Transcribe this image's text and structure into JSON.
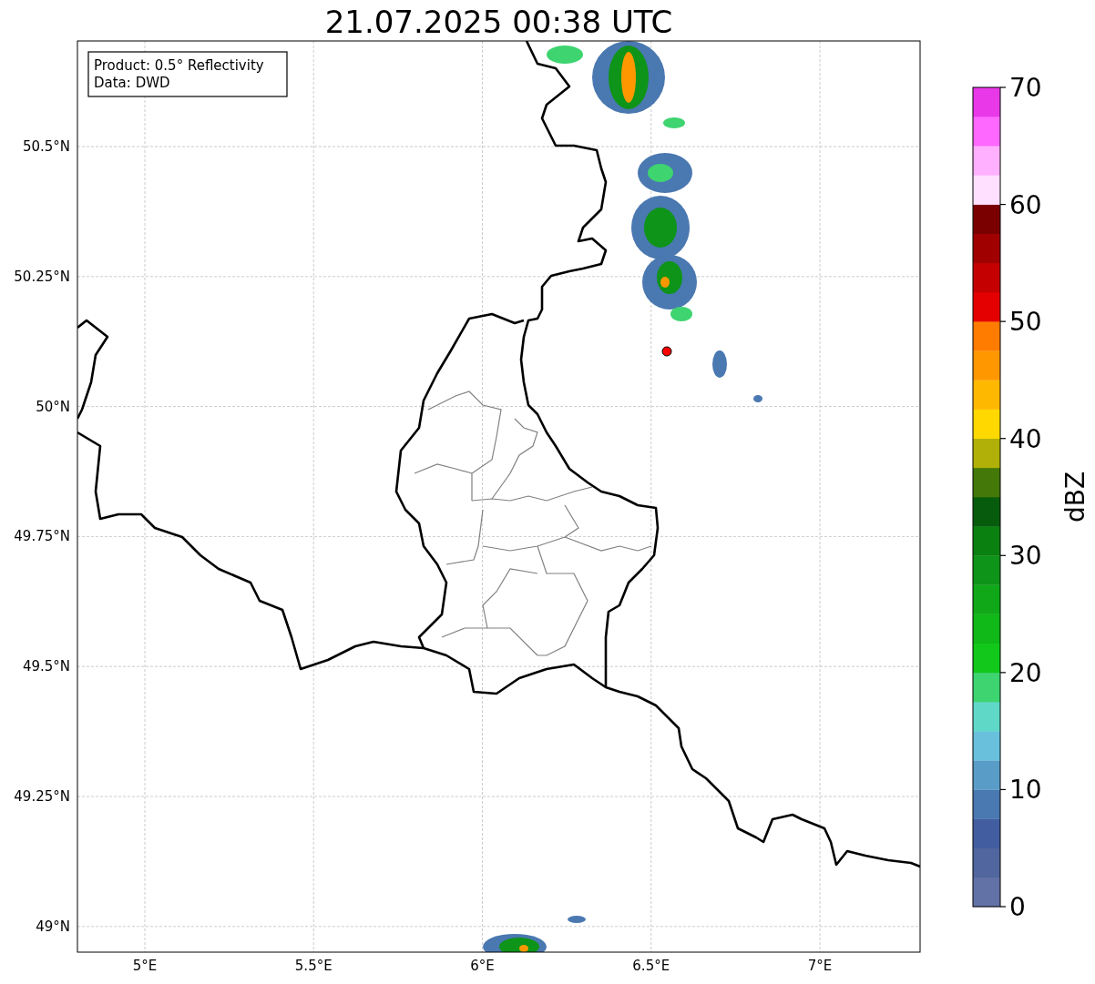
{
  "title": "21.07.2025 00:38 UTC",
  "info_box": {
    "lines": [
      "Product: 0.5° Reflectivity",
      "Data: DWD"
    ]
  },
  "map": {
    "x_labels": [
      "5°E",
      "5.5°E",
      "6°E",
      "6.5°E",
      "7°E"
    ],
    "y_labels": [
      "50.5°N",
      "50.25°N",
      "50°N",
      "49.75°N",
      "49.5°N",
      "49.25°N",
      "49°N"
    ]
  },
  "colorbar": {
    "label": "dBZ",
    "ticks": [
      "70",
      "60",
      "50",
      "40",
      "30",
      "20",
      "10",
      "0"
    ],
    "bands": [
      {
        "color": "#6372a6"
      },
      {
        "color": "#51669e"
      },
      {
        "color": "#425ea0"
      },
      {
        "color": "#4a78b0"
      },
      {
        "color": "#5a9cc8"
      },
      {
        "color": "#68c0dc"
      },
      {
        "color": "#60d8c8"
      },
      {
        "color": "#3ed470"
      },
      {
        "color": "#12c81a"
      },
      {
        "color": "#10b818"
      },
      {
        "color": "#10a818"
      },
      {
        "color": "#0e9418"
      },
      {
        "color": "#0a8010"
      },
      {
        "color": "#065c0c"
      },
      {
        "color": "#447808"
      },
      {
        "color": "#b0b008"
      },
      {
        "color": "#ffd800"
      },
      {
        "color": "#ffb800"
      },
      {
        "color": "#ff9800"
      },
      {
        "color": "#ff7c00"
      },
      {
        "color": "#e40000"
      },
      {
        "color": "#c40000"
      },
      {
        "color": "#a00000"
      },
      {
        "color": "#7a0000"
      },
      {
        "color": "#ffe0ff"
      },
      {
        "color": "#ffb0ff"
      },
      {
        "color": "#ff68ff"
      },
      {
        "color": "#e838e8"
      }
    ]
  }
}
